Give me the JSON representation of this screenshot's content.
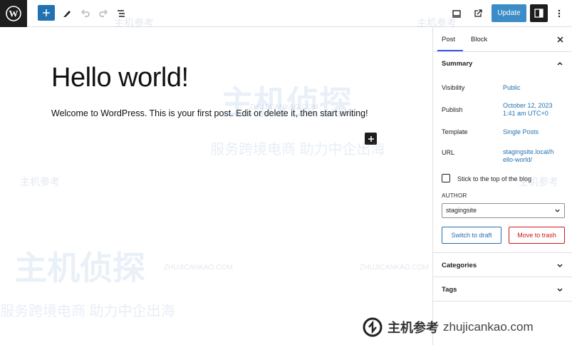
{
  "toolbar": {
    "update_label": "Update"
  },
  "editor": {
    "title": "Hello world!",
    "body": "Welcome to WordPress. This is your first post. Edit or delete it, then start writing!"
  },
  "sidebar": {
    "tabs": [
      {
        "label": "Post"
      },
      {
        "label": "Block"
      }
    ],
    "summary": {
      "heading": "Summary",
      "rows": [
        {
          "label": "Visibility",
          "value": "Public"
        },
        {
          "label": "Publish",
          "value_line1": "October 12, 2023",
          "value_line2": "1:41 am UTC+0"
        },
        {
          "label": "Template",
          "value": "Single Posts"
        },
        {
          "label": "URL",
          "value_line1": "stagingsite.local/h",
          "value_line2": "ello-world/"
        }
      ],
      "sticky_label": "Stick to the top of the blog",
      "author_label": "AUTHOR",
      "author_value": "stagingsite",
      "switch_draft_label": "Switch to draft",
      "trash_label": "Move to trash"
    },
    "categories_heading": "Categories",
    "tags_heading": "Tags"
  },
  "watermark": {
    "cn_small": "主机参考",
    "en_small": "ZHUJICANKAO.COM",
    "cn_big": "主机侦探",
    "cn_slogan": "服务跨境电商 助力中企出海",
    "footer_cn": "主机参考",
    "footer_domain": "zhujicankao.com"
  },
  "colors": {
    "accent": "#2271b1",
    "update_button": "#3c8dc7",
    "danger": "#cc1818",
    "dark": "#1e1e1e"
  }
}
